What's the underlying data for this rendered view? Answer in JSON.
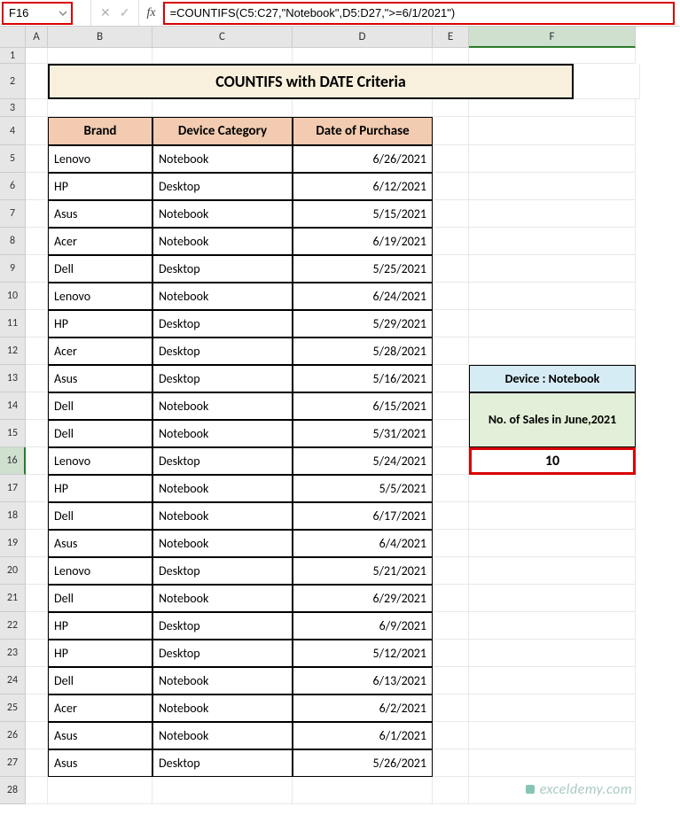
{
  "nameBox": "F16",
  "formula": "=COUNTIFS(C5:C27,\"Notebook\",D5:D27,\">=6/1/2021\")",
  "columns": [
    "A",
    "B",
    "C",
    "D",
    "E",
    "F"
  ],
  "title": "COUNTIFS with DATE Criteria",
  "headers": {
    "brand": "Brand",
    "category": "Device Category",
    "date": "Date of Purchase"
  },
  "rows": [
    {
      "brand": "Lenovo",
      "cat": "Notebook",
      "date": "6/26/2021"
    },
    {
      "brand": "HP",
      "cat": "Desktop",
      "date": "6/12/2021"
    },
    {
      "brand": "Asus",
      "cat": "Notebook",
      "date": "5/15/2021"
    },
    {
      "brand": "Acer",
      "cat": "Notebook",
      "date": "6/19/2021"
    },
    {
      "brand": "Dell",
      "cat": "Desktop",
      "date": "5/25/2021"
    },
    {
      "brand": "Lenovo",
      "cat": "Notebook",
      "date": "6/24/2021"
    },
    {
      "brand": "HP",
      "cat": "Desktop",
      "date": "5/29/2021"
    },
    {
      "brand": "Acer",
      "cat": "Desktop",
      "date": "5/28/2021"
    },
    {
      "brand": "Asus",
      "cat": "Desktop",
      "date": "5/16/2021"
    },
    {
      "brand": "Dell",
      "cat": "Notebook",
      "date": "6/15/2021"
    },
    {
      "brand": "Dell",
      "cat": "Notebook",
      "date": "5/31/2021"
    },
    {
      "brand": "Lenovo",
      "cat": "Desktop",
      "date": "5/24/2021"
    },
    {
      "brand": "HP",
      "cat": "Notebook",
      "date": "5/5/2021"
    },
    {
      "brand": "Dell",
      "cat": "Notebook",
      "date": "6/17/2021"
    },
    {
      "brand": "Asus",
      "cat": "Notebook",
      "date": "6/4/2021"
    },
    {
      "brand": "Lenovo",
      "cat": "Desktop",
      "date": "5/21/2021"
    },
    {
      "brand": "Dell",
      "cat": "Notebook",
      "date": "6/29/2021"
    },
    {
      "brand": "HP",
      "cat": "Desktop",
      "date": "6/9/2021"
    },
    {
      "brand": "HP",
      "cat": "Desktop",
      "date": "5/12/2021"
    },
    {
      "brand": "Dell",
      "cat": "Notebook",
      "date": "6/13/2021"
    },
    {
      "brand": "Acer",
      "cat": "Notebook",
      "date": "6/2/2021"
    },
    {
      "brand": "Asus",
      "cat": "Notebook",
      "date": "6/1/2021"
    },
    {
      "brand": "Asus",
      "cat": "Desktop",
      "date": "5/26/2021"
    }
  ],
  "side": {
    "device": "Device : Notebook",
    "label": "No. of Sales in June,2021",
    "result": "10"
  },
  "watermark": "exceldemy.com"
}
